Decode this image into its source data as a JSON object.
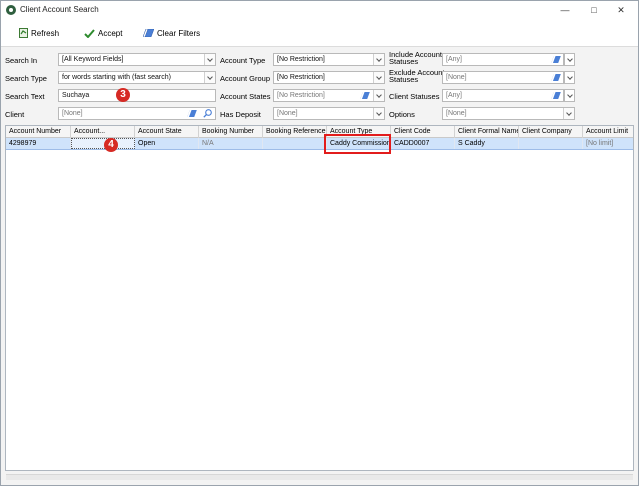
{
  "window": {
    "title": "Client Account Search",
    "minimize": "—",
    "maximize": "□",
    "close": "✕"
  },
  "toolbar": {
    "refresh": "Refresh",
    "accept": "Accept",
    "clear_filters": "Clear Filters"
  },
  "filters": {
    "search_in": {
      "label": "Search In",
      "value": "[All Keyword Fields]"
    },
    "search_type": {
      "label": "Search Type",
      "value": "for words starting with (fast search)"
    },
    "search_text": {
      "label": "Search Text",
      "value": "Suchaya"
    },
    "client": {
      "label": "Client",
      "value": "[None]"
    },
    "account_type": {
      "label": "Account Type",
      "value": "[No Restriction]"
    },
    "account_group": {
      "label": "Account Group",
      "value": "[No Restriction]"
    },
    "account_states": {
      "label": "Account States",
      "value": "[No Restriction]"
    },
    "has_deposit": {
      "label": "Has Deposit",
      "value": "[None]"
    },
    "include_account_statuses": {
      "label_line1": "Include Account",
      "label_line2": "Statuses",
      "value": "[Any]"
    },
    "exclude_account_statuses": {
      "label_line1": "Exclude Account",
      "label_line2": "Statuses",
      "value": "[None]"
    },
    "client_statuses": {
      "label": "Client Statuses",
      "value": "[Any]"
    },
    "options": {
      "label": "Options",
      "value": "[None]"
    }
  },
  "grid": {
    "columns": [
      "Account Number",
      "Account...",
      "Account State",
      "Booking Number",
      "Booking Reference",
      "Account Type",
      "Client Code",
      "Client Formal Name",
      "Client Company",
      "Account Limit"
    ],
    "rows": [
      [
        "4298979",
        "",
        "Open",
        "N/A",
        "",
        "Caddy Commission",
        "CADD0007",
        "S Caddy",
        "",
        "[No limit]"
      ]
    ]
  },
  "annotations": {
    "step3": "3",
    "step4": "4"
  },
  "colors": {
    "selected_row": "#cfe3fb",
    "marker": "#d62a24",
    "highlight": "#e21c1c"
  }
}
